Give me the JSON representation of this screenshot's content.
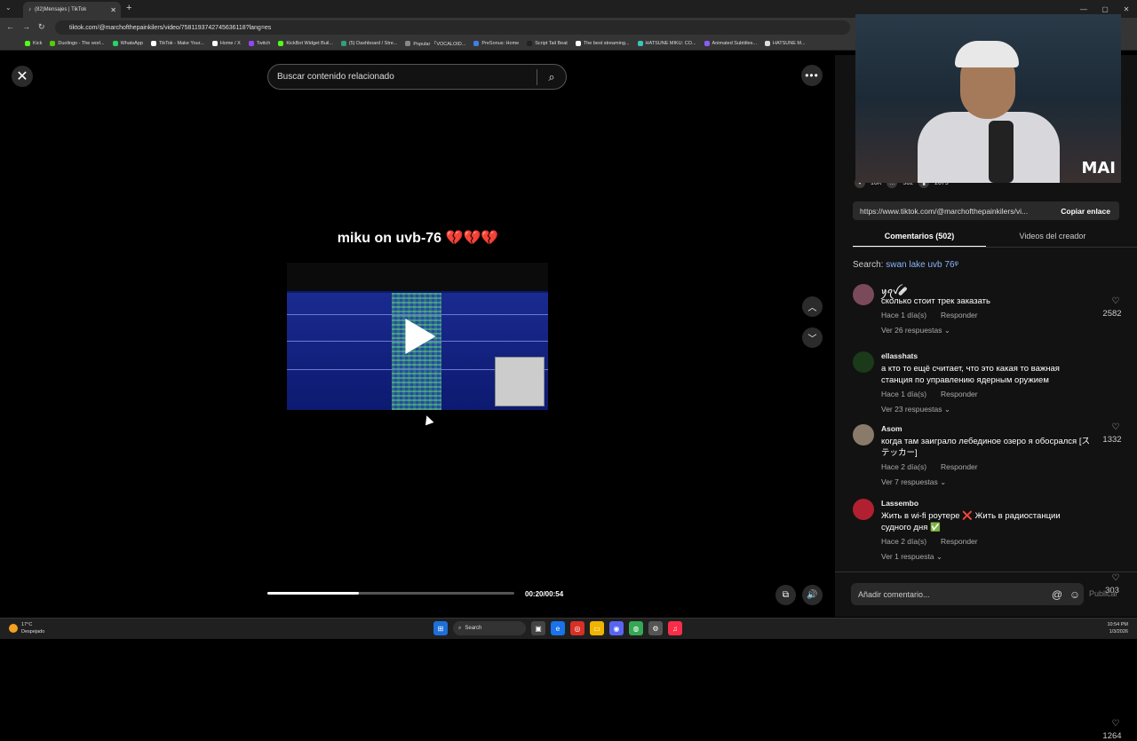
{
  "browser": {
    "tab_title": "(82)Mensajes | TikTok",
    "url": "tiktok.com/@marchofthepainkilers/video/7581193742745636118?lang=es",
    "bookmarks": [
      {
        "label": "Kick",
        "color": "#53fc18"
      },
      {
        "label": "Duolingo - The worl...",
        "color": "#58cc02"
      },
      {
        "label": "WhatsApp",
        "color": "#25d366"
      },
      {
        "label": "TikTok - Make Your...",
        "color": "#ffffff"
      },
      {
        "label": "Home / X",
        "color": "#ffffff"
      },
      {
        "label": "Twitch",
        "color": "#9146ff"
      },
      {
        "label": "KickBot Widget Buil...",
        "color": "#53fc18"
      },
      {
        "label": "(5) Dashboard / Stre...",
        "color": "#2fa07a"
      },
      {
        "label": "Popular 「VOCALOID...",
        "color": "#888888"
      },
      {
        "label": "PreSonus: Home",
        "color": "#3f7fe0"
      },
      {
        "label": "Script Tail Beat",
        "color": "#222222"
      },
      {
        "label": "The best streaming...",
        "color": "#ffffff"
      },
      {
        "label": "HATSUNE MIKU: CO...",
        "color": "#39c5bb"
      },
      {
        "label": "Animated Subtitles...",
        "color": "#8a5cf6"
      },
      {
        "label": "HATSUNE M...",
        "color": "#dddddd"
      }
    ]
  },
  "video": {
    "search_placeholder": "Buscar contenido relacionado",
    "caption": "miku on uvb-76 💔💔💔",
    "time": "00:20/00:54",
    "progress": 0.37
  },
  "stats": {
    "likes": "16K",
    "comments": "502",
    "saves": "2679"
  },
  "panel": {
    "link": "https://www.tiktok.com/@marchofthepainkilers/vi...",
    "copy_label": "Copiar enlace",
    "tab_comments": "Comentarios (502)",
    "tab_videos": "Videos del creador",
    "search_prefix": "Search:",
    "search_query": "swan lake uvb 76",
    "webcam_logo": "MAI"
  },
  "comments": [
    {
      "user": "ꪗꪖꪜ🩹",
      "text": "сколько стоит трек заказать",
      "time": "Hace 1 día(s)",
      "reply": "Responder",
      "replies": "Ver 26 respuestas ⌄",
      "likes": "2582",
      "avatar_color": "#7a4a5a"
    },
    {
      "user": "ellasshats",
      "text": "а кто то ещё считает, что это какая то важная станция по управлению ядерным оружием",
      "time": "Hace 1 día(s)",
      "reply": "Responder",
      "replies": "Ver 23 respuestas ⌄",
      "likes": "1332",
      "avatar_color": "#1a3a1a"
    },
    {
      "user": "Asom",
      "text": "когда там заиграло лебединое озеро я обосрался [ステッカー]",
      "time": "Hace 2 día(s)",
      "reply": "Responder",
      "replies": "Ver 7 respuestas ⌄",
      "likes": "303",
      "avatar_color": "#8a7a6a"
    },
    {
      "user": "Lassembo",
      "text": "Жить в wi-fi роутере ❌ Жить в радиостанции судного дня ✅",
      "time": "Hace 2 día(s)",
      "reply": "Responder",
      "replies": "Ver 1 respuesta ⌄",
      "likes": "1264",
      "avatar_color": "#b02030"
    }
  ],
  "comment_box": {
    "placeholder": "Añadir comentario...",
    "publish": "Publicar"
  },
  "taskbar": {
    "temp": "17°C",
    "weather": "Despejado",
    "search": "Search",
    "time": "10:54 PM",
    "date": "1/3/2026"
  }
}
